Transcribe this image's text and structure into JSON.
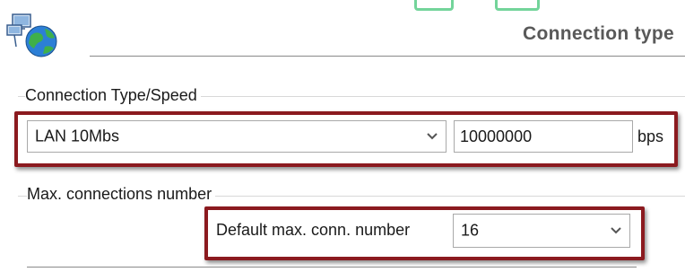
{
  "header": {
    "title": "Connection type"
  },
  "connection_group": {
    "label": "Connection Type/Speed",
    "type_select": {
      "value": "LAN 10Mbs"
    },
    "speed_input": {
      "value": "10000000"
    },
    "speed_unit": "bps"
  },
  "max_connections_group": {
    "label": "Max. connections number",
    "default_label": "Default max. conn. number",
    "default_select": {
      "value": "16"
    }
  },
  "colors": {
    "highlight_frame": "#8b1a1f",
    "accent_green": "#73d49a"
  },
  "icons": {
    "logo": "network-globe-icon",
    "dropdown": "chevron-down-icon"
  }
}
